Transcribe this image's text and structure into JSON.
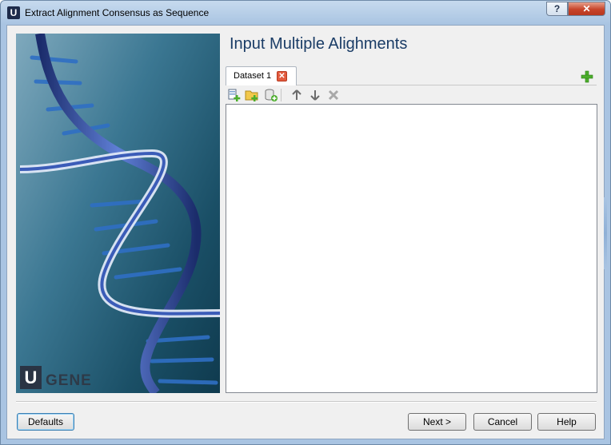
{
  "window": {
    "title": "Extract Alignment Consensus as Sequence",
    "app_icon_letter": "U",
    "help_glyph": "?",
    "close_glyph": "✕"
  },
  "banner": {
    "logo_letter": "U",
    "logo_text": "GENE"
  },
  "page": {
    "title": "Input Multiple Alighments"
  },
  "tabs": [
    {
      "label": "Dataset 1",
      "close_glyph": "✕"
    }
  ],
  "toolbar": {
    "items": [
      "add-file-icon",
      "add-folder-icon",
      "add-database-icon",
      "arrow-up-icon",
      "arrow-down-icon",
      "remove-icon"
    ]
  },
  "buttons": {
    "defaults": "Defaults",
    "next": "Next >",
    "cancel": "Cancel",
    "help": "Help"
  },
  "colors": {
    "accent_title": "#1a3c66",
    "close_red": "#c7442a",
    "plus_green": "#4cae2c"
  }
}
